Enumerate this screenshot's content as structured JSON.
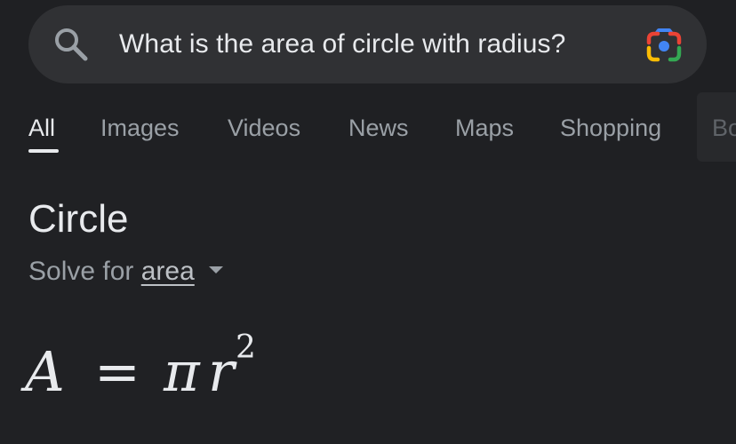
{
  "search": {
    "query": "What is the area of circle with radius?",
    "search_icon": "search-icon",
    "lens_icon": "google-lens-icon"
  },
  "tabs": [
    {
      "label": "All",
      "active": true
    },
    {
      "label": "Images",
      "active": false
    },
    {
      "label": "Videos",
      "active": false
    },
    {
      "label": "News",
      "active": false
    },
    {
      "label": "Maps",
      "active": false
    },
    {
      "label": "Shopping",
      "active": false
    }
  ],
  "tab_partial": "Bo",
  "result": {
    "title": "Circle",
    "solve_prefix": "Solve for",
    "solve_variable": "area",
    "formula": {
      "lhs": "A",
      "equals": "=",
      "pi": "π",
      "r": "r",
      "exponent": "2"
    }
  },
  "colors": {
    "background": "#202124",
    "search_bar": "#303134",
    "text_primary": "#e8eaed",
    "text_secondary": "#9aa0a6"
  }
}
